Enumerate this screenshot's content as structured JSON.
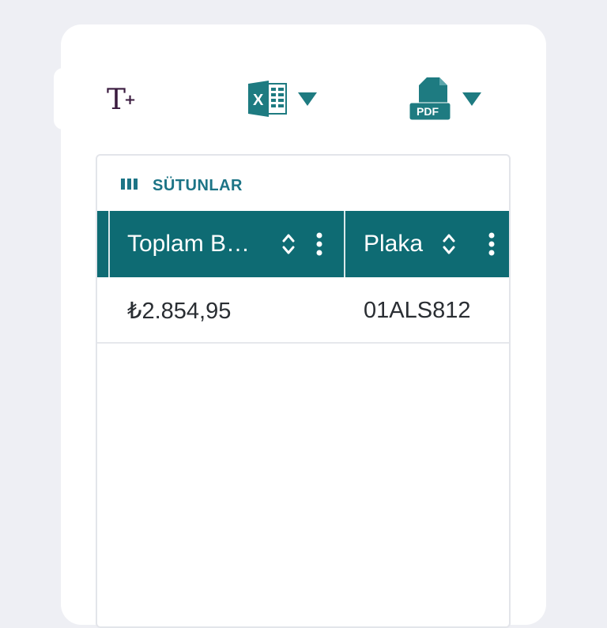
{
  "toolbar": {
    "text_size_icon": "text-size-plus-icon",
    "excel_icon": "excel-icon",
    "pdf_label": "PDF",
    "pdf_icon": "pdf-icon",
    "caret_icon": "caret-down-icon",
    "excel_letter": "X"
  },
  "grid": {
    "columns_button_label": "SÜTUNLAR",
    "columns_icon": "columns-icon",
    "headers": [
      {
        "label": "Toplam B…"
      },
      {
        "label": "Plaka"
      }
    ],
    "rows": [
      {
        "cells": [
          "₺2.854,95",
          "01ALS812"
        ]
      }
    ]
  },
  "colors": {
    "accent": "#0e6b73",
    "link": "#1c7486",
    "text_icon": "#3a1b3f"
  }
}
